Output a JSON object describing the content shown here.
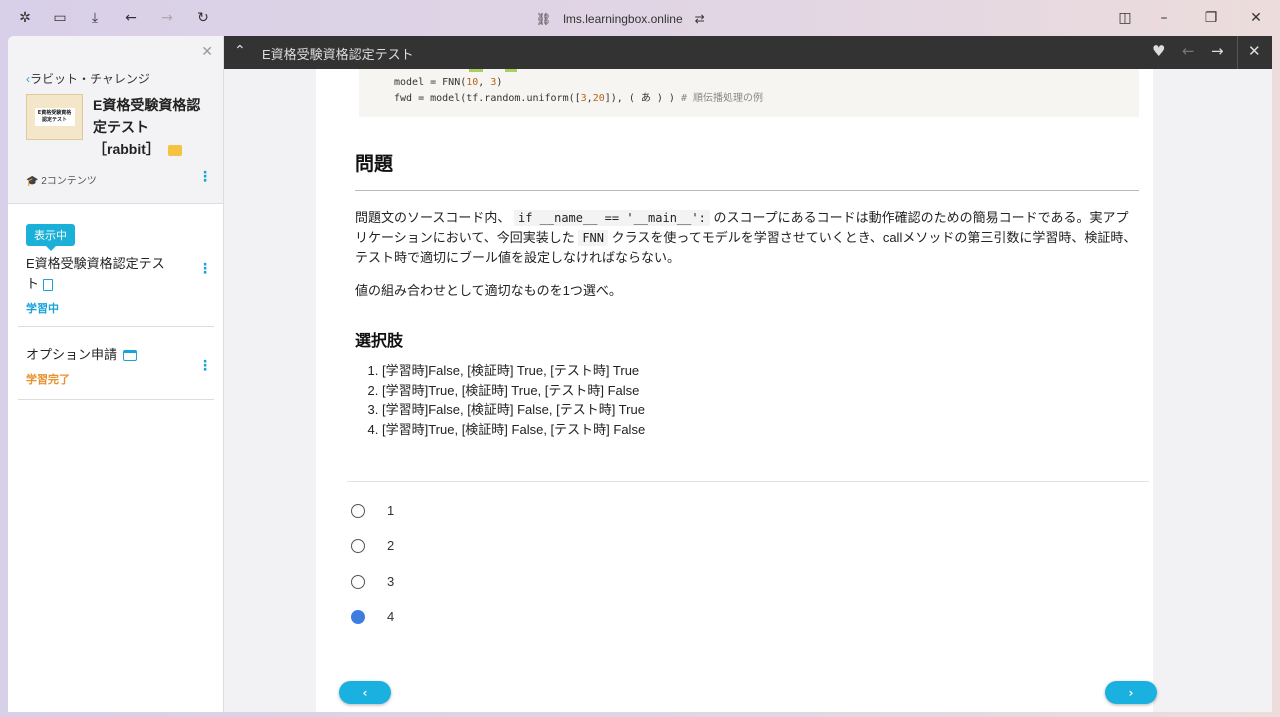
{
  "browser": {
    "url": "lms.learningbox.online"
  },
  "sidebar": {
    "back_label": "ラビット・チャレンジ",
    "thumbnail_text": "E資格受験資格認定テスト",
    "course_title_line1": "E資格受験資格認",
    "course_title_line2": "定テスト",
    "course_title_line3": "［rabbit］",
    "content_count": "2コンテンツ",
    "items": [
      {
        "badge": "表示中",
        "title_line1": "E資格受験資格認定テス",
        "title_line2": "ト",
        "status": "学習中"
      },
      {
        "title": "オプション申請",
        "status": "学習完了"
      }
    ]
  },
  "topbar": {
    "title": "E資格受験資格認定テスト"
  },
  "code": {
    "line1_a": "model = FNN(",
    "line1_n1": "10",
    "line1_b": ", ",
    "line1_n2": "3",
    "line1_c": ")",
    "line2_a": "fwd = model(tf.random.uniform([",
    "line2_n1": "3",
    "line2_b": ",",
    "line2_n2": "20",
    "line2_c": "]), ( あ ) ) ",
    "line2_comment": "# 順伝播処理の例"
  },
  "question": {
    "heading": "問題",
    "para1_a": "問題文のソースコード内、",
    "para1_code1": "if __name__ == '__main__':",
    "para1_b": "のスコープにあるコードは動作確認のための簡易コードである。実アプリケーションにおいて、今回実装した",
    "para1_code2": "FNN",
    "para1_c": "クラスを使ってモデルを学習させていくとき、callメソッドの第三引数に学習時、検証時、テスト時で適切にブール値を設定しなければならない。",
    "para2": "値の組み合わせとして適切なものを1つ選べ。",
    "options_heading": "選択肢",
    "choices": [
      "[学習時]False, [検証時] True, [テスト時] True",
      "[学習時]True, [検証時] True, [テスト時] False",
      "[学習時]False, [検証時] False, [テスト時] True",
      "[学習時]True, [検証時] False, [テスト時] False"
    ]
  },
  "answers": {
    "options": [
      "1",
      "2",
      "3",
      "4"
    ],
    "selected": "4"
  },
  "pager": {
    "prev_label": "‹",
    "next_label": "›"
  }
}
